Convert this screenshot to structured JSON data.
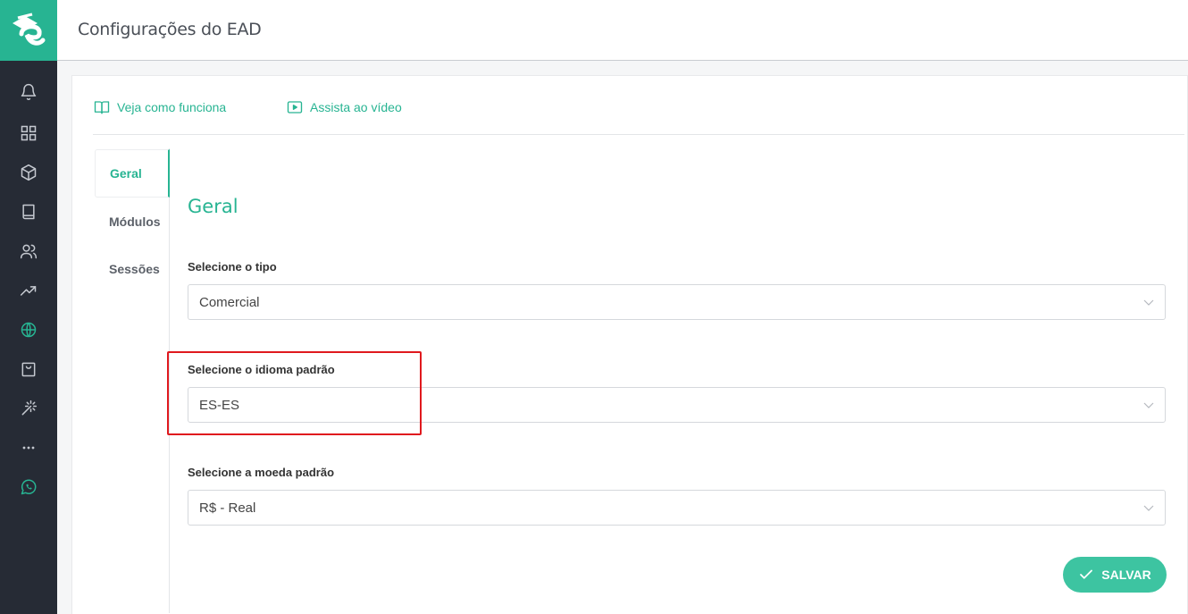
{
  "header": {
    "title": "Configurações do EAD"
  },
  "sidebar": {
    "items": [
      {
        "icon": "bell-icon"
      },
      {
        "icon": "grid-icon"
      },
      {
        "icon": "cube-icon"
      },
      {
        "icon": "book-icon"
      },
      {
        "icon": "users-icon"
      },
      {
        "icon": "trending-up-icon"
      },
      {
        "icon": "globe-icon",
        "active": true
      },
      {
        "icon": "shopping-bag-icon"
      },
      {
        "icon": "magic-wand-icon"
      },
      {
        "icon": "more-icon"
      },
      {
        "icon": "whatsapp-icon"
      }
    ]
  },
  "help": {
    "how_it_works": "Veja como funciona",
    "watch_video": "Assista ao vídeo"
  },
  "tabs": [
    {
      "label": "Geral",
      "active": true
    },
    {
      "label": "Módulos"
    },
    {
      "label": "Sessões"
    }
  ],
  "form": {
    "section_title": "Geral",
    "type_label": "Selecione o tipo",
    "type_value": "Comercial",
    "language_label": "Selecione o idioma padrão",
    "language_value": "ES-ES",
    "currency_label": "Selecione a moeda padrão",
    "currency_value": "R$ - Real",
    "save_label": "SALVAR"
  },
  "colors": {
    "accent": "#27b492",
    "sidebar_bg": "#262b35",
    "highlight": "#e0191e"
  }
}
